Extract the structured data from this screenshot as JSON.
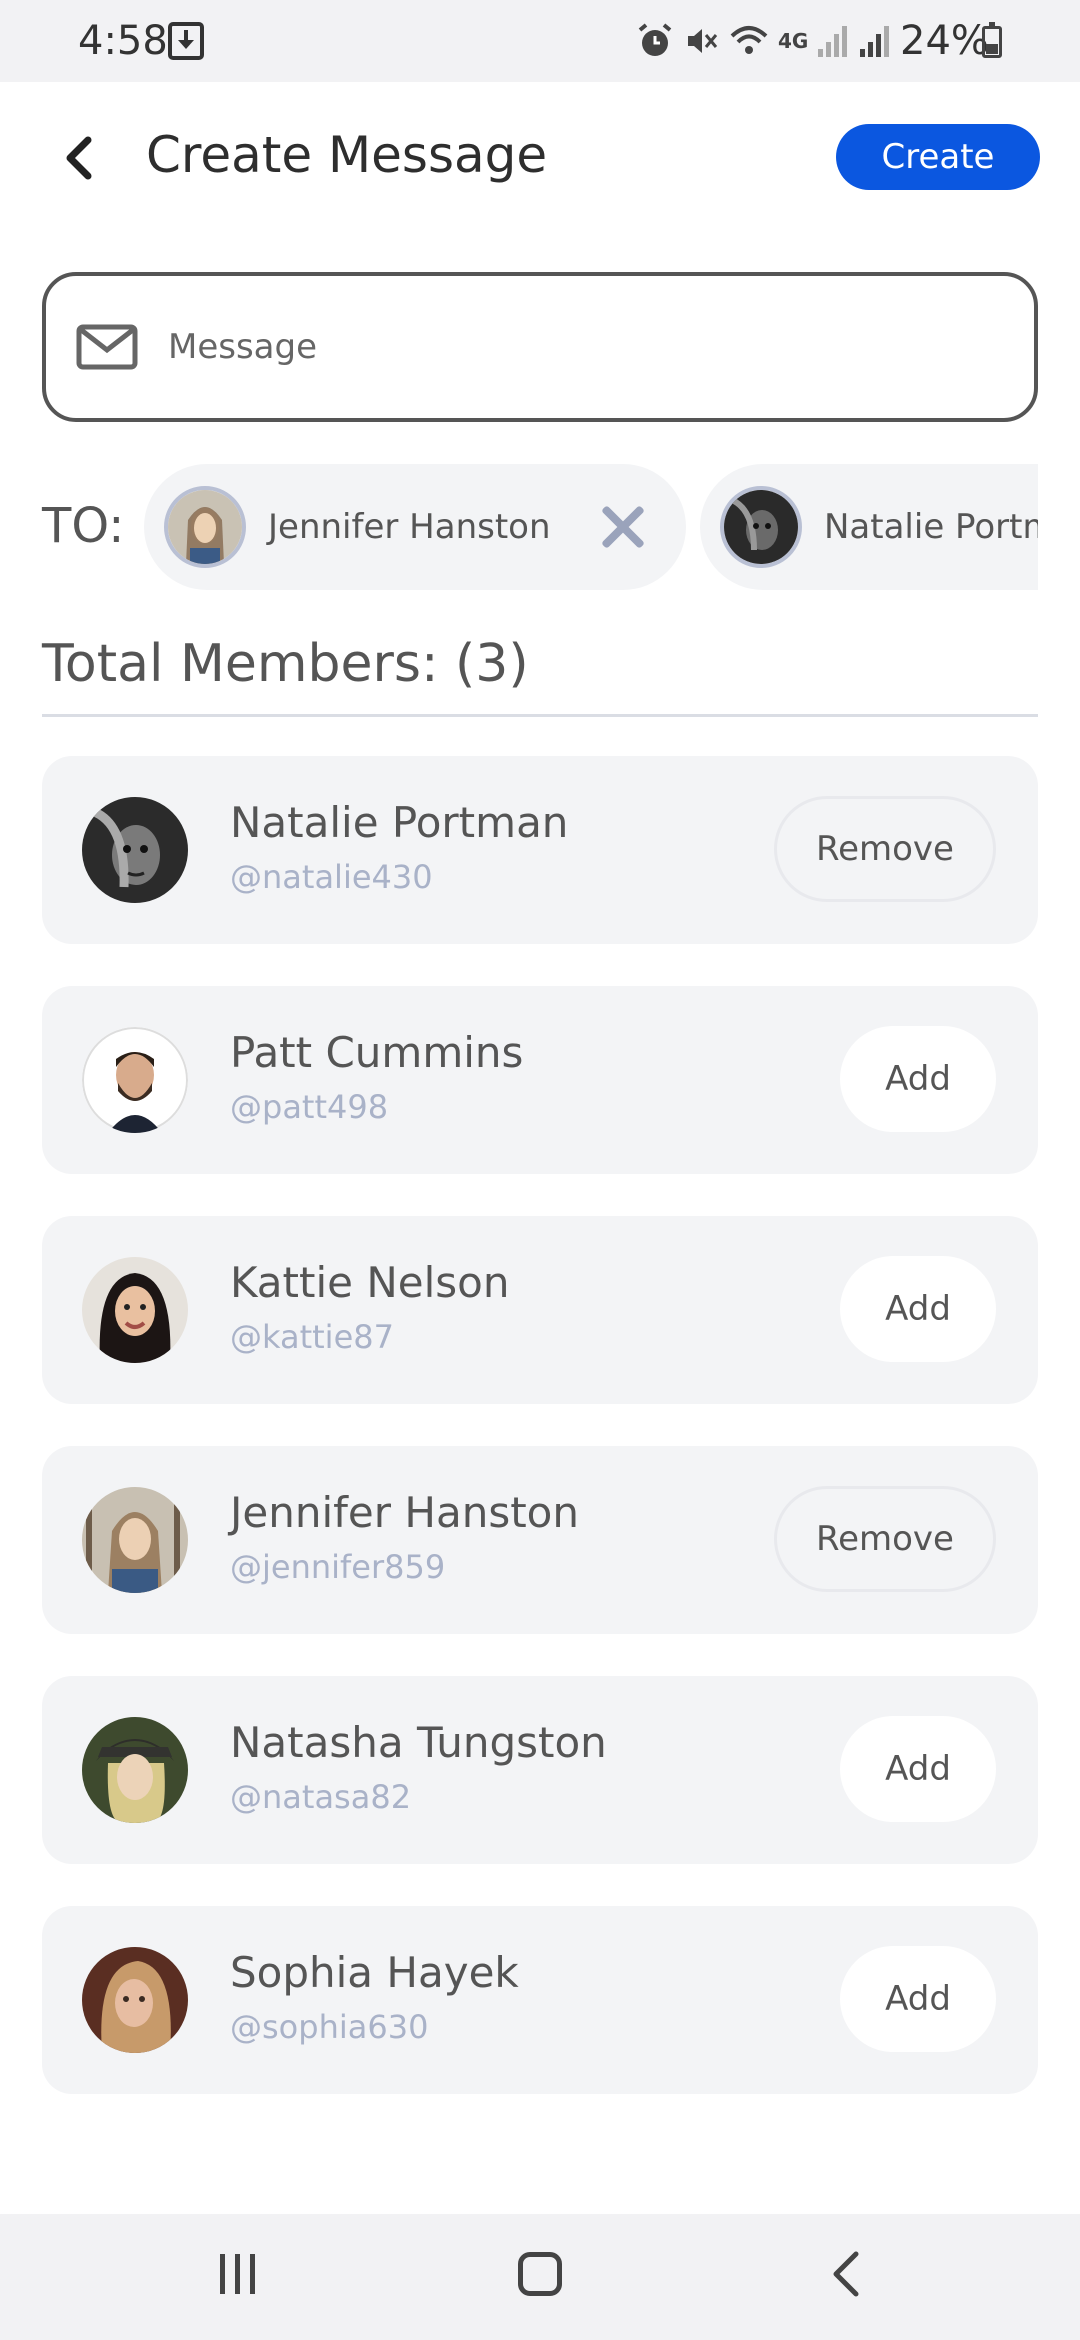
{
  "status_bar": {
    "time": "4:58",
    "network": "4G",
    "battery": "24%",
    "icons": [
      "download-icon",
      "alarm-icon",
      "mute-icon",
      "wifi-icon",
      "signal-icon",
      "battery-icon"
    ]
  },
  "header": {
    "title": "Create Message",
    "create_label": "Create",
    "back_icon": "chevron-left-icon"
  },
  "message": {
    "placeholder": "Message",
    "value": ""
  },
  "to": {
    "label": "TO:",
    "chips": [
      {
        "name": "Jennifer Hanston",
        "avatar_color": "#8a6f55"
      },
      {
        "name": "Natalie Portman",
        "avatar_color": "#333333"
      }
    ]
  },
  "members": {
    "heading": "Total Members: (3)",
    "list": [
      {
        "name": "Natalie Portman",
        "handle": "@natalie430",
        "action": "Remove",
        "avatar_color": "#3a3a3a"
      },
      {
        "name": "Patt Cummins",
        "handle": "@patt498",
        "action": "Add",
        "avatar_color": "#5b4636"
      },
      {
        "name": "Kattie Nelson",
        "handle": "@kattie87",
        "action": "Add",
        "avatar_color": "#2c2222"
      },
      {
        "name": "Jennifer Hanston",
        "handle": "@jennifer859",
        "action": "Remove",
        "avatar_color": "#8d7a62"
      },
      {
        "name": "Natasha Tungston",
        "handle": "@natasa82",
        "action": "Add",
        "avatar_color": "#4a5a3a"
      },
      {
        "name": "Sophia Hayek",
        "handle": "@sophia630",
        "action": "Add",
        "avatar_color": "#7a4a3a"
      }
    ]
  },
  "colors": {
    "accent": "#0b57e0",
    "card_bg": "#f3f4f6",
    "handle": "#a9b2c8"
  }
}
